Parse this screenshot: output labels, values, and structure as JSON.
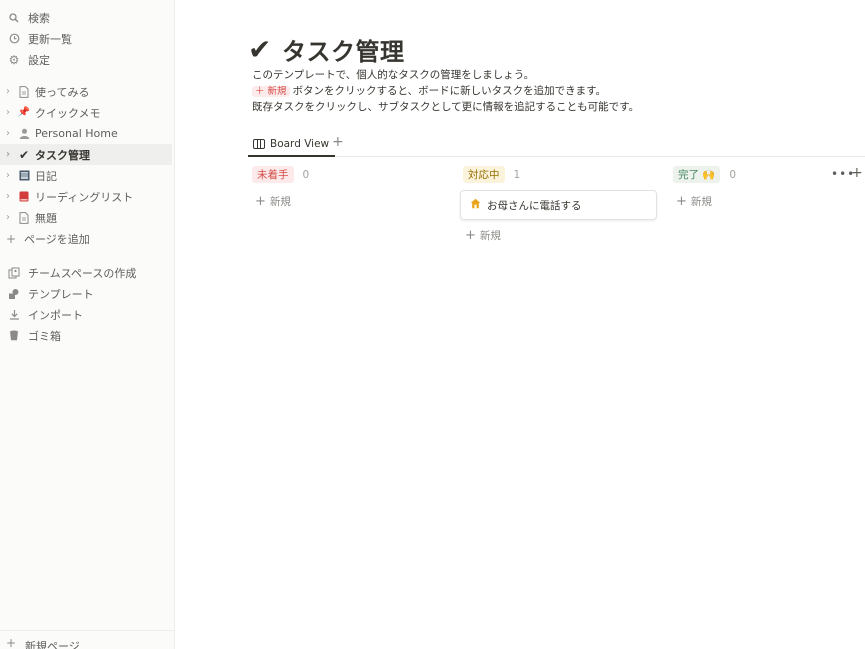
{
  "sidebar": {
    "top_items": [
      {
        "label": "検索",
        "icon": "search-icon"
      },
      {
        "label": "更新一覧",
        "icon": "clock-icon"
      },
      {
        "label": "設定",
        "icon": "gear-icon"
      }
    ],
    "pages": [
      {
        "label": "使ってみる",
        "icon": "page-icon"
      },
      {
        "label": "クイックメモ",
        "icon": "pushpin-icon"
      },
      {
        "label": "Personal Home",
        "icon": "person-icon"
      },
      {
        "label": "タスク管理",
        "icon": "checkmark-icon"
      },
      {
        "label": "日記",
        "icon": "notebook-icon"
      },
      {
        "label": "リーディングリスト",
        "icon": "red-book-icon"
      },
      {
        "label": "無題",
        "icon": "page-icon"
      }
    ],
    "add_page_label": "ページを追加",
    "tools": [
      {
        "label": "チームスペースの作成",
        "icon": "teamspace-icon"
      },
      {
        "label": "テンプレート",
        "icon": "shapes-icon"
      },
      {
        "label": "インポート",
        "icon": "download-icon"
      },
      {
        "label": "ゴミ箱",
        "icon": "trash-icon"
      }
    ],
    "new_page_label": "新規ページ"
  },
  "page": {
    "title_icon": "✔",
    "title": "タスク管理",
    "desc_line1": "このテンプレートで、個人的なタスクの管理をしましょう。",
    "desc_line2_chip": "＋ 新規",
    "desc_line2_rest": "ボタンをクリックすると、ボードに新しいタスクを追加できます。",
    "desc_line3": "既存タスクをクリックし、サブタスクとして更に情報を追記することも可能です。"
  },
  "view": {
    "tab_label": "Board View"
  },
  "board": {
    "columns": [
      {
        "label": "未着手",
        "count": "0",
        "color": "#d44c47",
        "bg": "#fdebec",
        "new_label": "新規"
      },
      {
        "label": "対応中",
        "count": "1",
        "color": "#976d00",
        "bg": "#fbf3db",
        "new_label": "新規"
      },
      {
        "label": "完了 🙌",
        "count": "0",
        "color": "#448361",
        "bg": "#edf3ec",
        "new_label": "新規"
      }
    ],
    "cards": [
      {
        "title": "お母さんに電話する",
        "icon": "house-icon"
      }
    ]
  }
}
